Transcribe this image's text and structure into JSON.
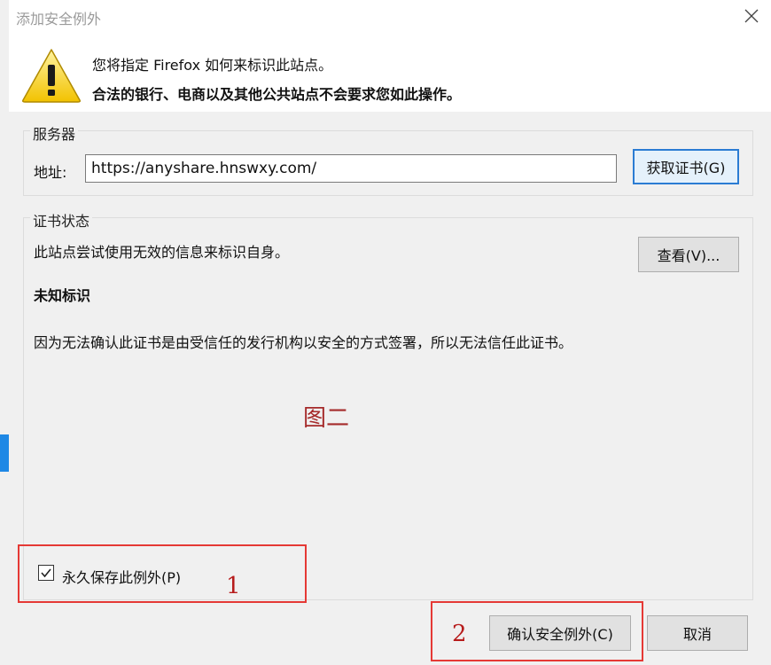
{
  "dialog": {
    "title": "添加安全例外",
    "message_line1": "您将指定 Firefox 如何来标识此站点。",
    "message_line2": "合法的银行、电商以及其他公共站点不会要求您如此操作。"
  },
  "server": {
    "group_title": "服务器",
    "address_label": "地址:",
    "address_value": "https://anyshare.hnswxy.com/",
    "get_cert_button": "获取证书(G)"
  },
  "cert_status": {
    "group_title": "证书状态",
    "status_text": "此站点尝试使用无效的信息来标识自身。",
    "view_button": "查看(V)...",
    "issue_heading": "未知标识",
    "issue_detail": "因为无法确认此证书是由受信任的发行机构以安全的方式签署，所以无法信任此证书。"
  },
  "permanent_checkbox": {
    "label": "永久保存此例外(P)",
    "checked": true
  },
  "buttons": {
    "confirm": "确认安全例外(C)",
    "cancel": "取消"
  },
  "annotations": {
    "figure_label": "图二",
    "step1": "1",
    "step2": "2",
    "highlight_color": "#e53935"
  },
  "icons": {
    "warning": "warning-icon",
    "close": "close-icon",
    "check": "check-icon"
  }
}
